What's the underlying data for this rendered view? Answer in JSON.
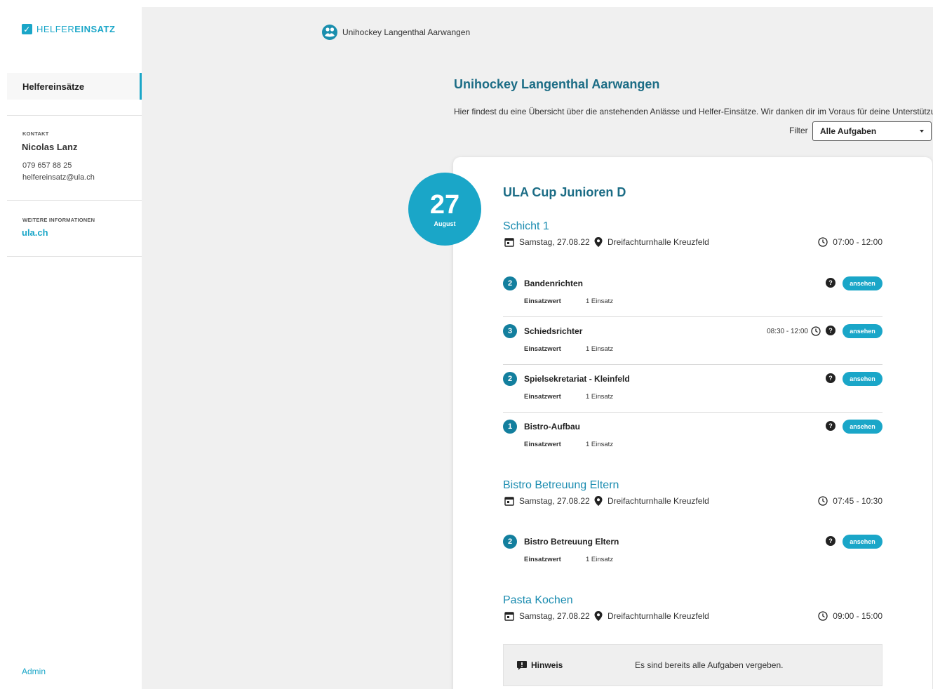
{
  "sidebar": {
    "logo_a": "HELFER",
    "logo_b": "EINSATZ",
    "nav_active": "Helfereinsätze",
    "contact_label": "KONTAKT",
    "contact_name": "Nicolas Lanz",
    "contact_phone": "079 657 88 25",
    "contact_email": "helfereinsatz@ula.ch",
    "info_label": "WEITERE INFORMATIONEN",
    "info_link": "ula.ch",
    "admin": "Admin"
  },
  "header": {
    "org_name": "Unihockey Langenthal Aarwangen"
  },
  "main": {
    "title": "Unihockey Langenthal Aarwangen",
    "intro": "Hier findest du eine Übersicht über die anstehenden Anlässe und Helfer-Einsätze. Wir danken dir im Voraus für deine Unterstützung!",
    "filter_label": "Filter",
    "filter_value": "Alle Aufgaben"
  },
  "event": {
    "day": "27",
    "month": "August",
    "title": "ULA Cup Junioren D",
    "shifts": [
      {
        "title": "Schicht 1",
        "date": "Samstag, 27.08.22",
        "location": "Dreifachturnhalle Kreuzfeld",
        "time": "07:00 - 12:00",
        "tasks": [
          {
            "count": "2",
            "name": "Bandenrichten",
            "ew_label": "Einsatzwert",
            "ew_value": "1 Einsatz",
            "button": "ansehen",
            "time": ""
          },
          {
            "count": "3",
            "name": "Schiedsrichter",
            "ew_label": "Einsatzwert",
            "ew_value": "1 Einsatz",
            "button": "ansehen",
            "time": "08:30 - 12:00"
          },
          {
            "count": "2",
            "name": "Spielsekretariat - Kleinfeld",
            "ew_label": "Einsatzwert",
            "ew_value": "1 Einsatz",
            "button": "ansehen",
            "time": ""
          },
          {
            "count": "1",
            "name": "Bistro-Aufbau",
            "ew_label": "Einsatzwert",
            "ew_value": "1 Einsatz",
            "button": "ansehen",
            "time": ""
          }
        ]
      },
      {
        "title": "Bistro Betreuung Eltern",
        "date": "Samstag, 27.08.22",
        "location": "Dreifachturnhalle Kreuzfeld",
        "time": "07:45 - 10:30",
        "tasks": [
          {
            "count": "2",
            "name": "Bistro Betreuung Eltern",
            "ew_label": "Einsatzwert",
            "ew_value": "1 Einsatz",
            "button": "ansehen",
            "time": ""
          }
        ]
      },
      {
        "title": "Pasta Kochen",
        "date": "Samstag, 27.08.22",
        "location": "Dreifachturnhalle Kreuzfeld",
        "time": "09:00 - 15:00",
        "hint_title": "Hinweis",
        "hint_text": "Es sind bereits alle Aufgaben vergeben."
      }
    ]
  },
  "colors": {
    "accent": "#1aa6c8",
    "title": "#1b6c85",
    "badge": "#137f9e"
  },
  "icons": [
    "check-icon",
    "org-logo-icon",
    "calendar-icon",
    "location-pin-icon",
    "clock-icon",
    "question-icon",
    "alert-icon",
    "caret-down-icon"
  ]
}
